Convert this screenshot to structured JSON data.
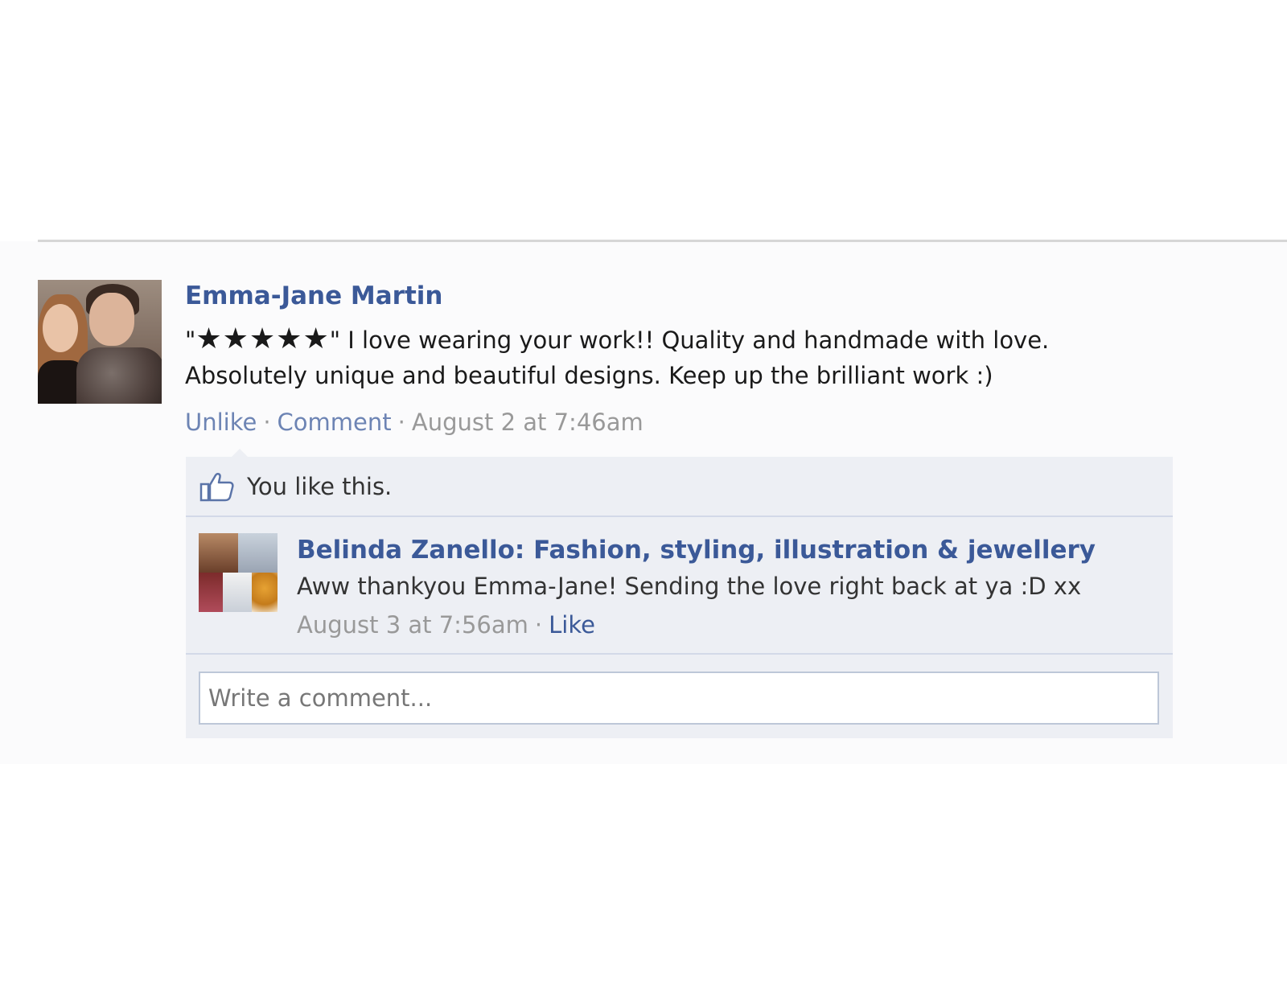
{
  "post": {
    "author": "Emma-Jane Martin",
    "quote_open": "\"",
    "stars": "★★★★★",
    "quote_close": "\"",
    "body_line1": " I love wearing your work!! Quality and handmade with love.",
    "body_line2": "Absolutely unique and beautiful designs. Keep up the brilliant work :)",
    "actions": {
      "unlike": "Unlike",
      "comment": "Comment",
      "separator": "·",
      "timestamp": "August 2 at 7:46am"
    }
  },
  "likes": {
    "text": "You like this."
  },
  "comment": {
    "author": "Belinda Zanello: Fashion, styling, illustration & jewellery",
    "text": "Aww thankyou Emma-Jane! Sending the love right back at ya :D xx",
    "timestamp": "August 3 at 7:56am",
    "separator": "·",
    "like": "Like"
  },
  "comment_box": {
    "placeholder": "Write a comment..."
  },
  "colors": {
    "link": "#3b5998",
    "link_light": "#6d84b4",
    "ufi_background": "#edeff4",
    "muted_text": "#999999"
  },
  "icons": {
    "like": "thumbs-up-icon"
  }
}
